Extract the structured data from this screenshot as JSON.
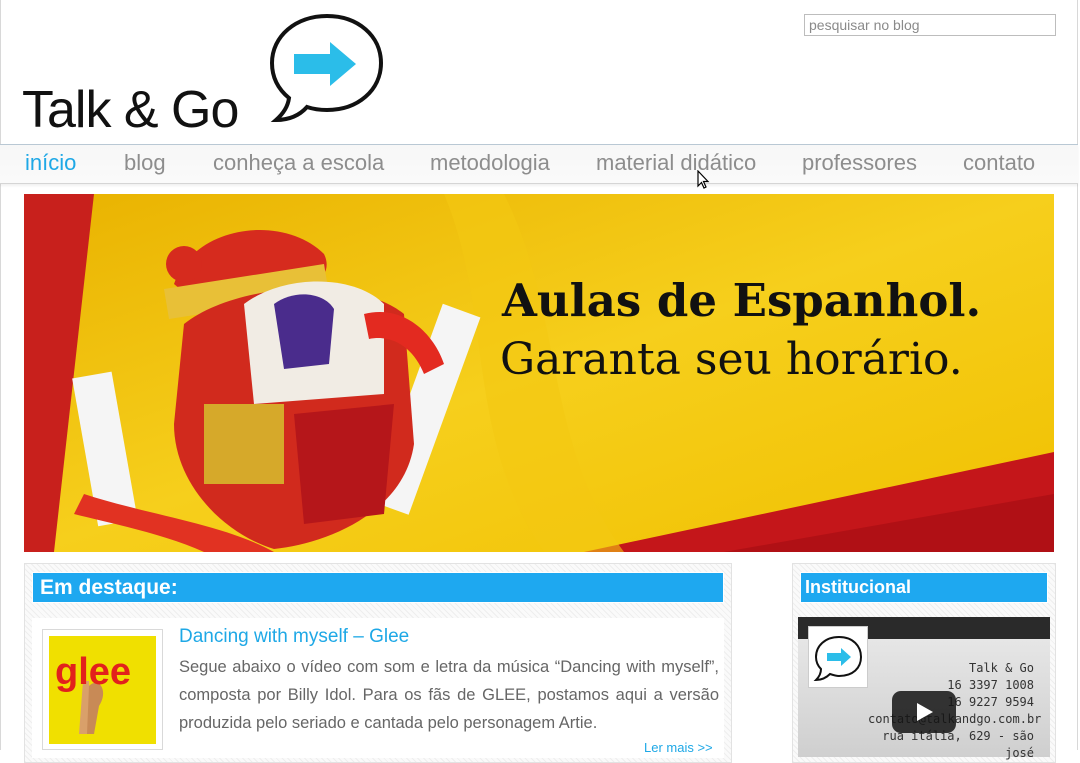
{
  "logo": {
    "text": "Talk & Go"
  },
  "search": {
    "placeholder": "pesquisar no blog",
    "value": ""
  },
  "nav": {
    "items": [
      "início",
      "blog",
      "conheça a escola",
      "metodologia",
      "material didático",
      "professores",
      "contato"
    ],
    "active": "início"
  },
  "banner": {
    "title": "Aulas de Espanhol.",
    "subtitle": "Garanta seu horário."
  },
  "featured": {
    "heading": "Em destaque:",
    "post": {
      "title": "Dancing with myself – Glee",
      "excerpt": "Segue abaixo o vídeo com som e letra da música “Dancing with myself”, composta por Billy Idol. Para os fãs de GLEE, postamos aqui a versão produzida pelo seriado e cantada pelo personagem Artie.",
      "thumb_text": "glee",
      "read_more": "Ler mais >>"
    }
  },
  "sidebar": {
    "heading": "Institucional",
    "video": {
      "lines": [
        "Talk & Go",
        "16 3397 1008",
        "16 9227 9594",
        "contato@talkandgo.com.br",
        "rua itália, 629 - são josé"
      ]
    }
  },
  "colors": {
    "accent": "#1ea8e6",
    "header_bar": "#1ea8f0",
    "arrow": "#2bbde9"
  }
}
